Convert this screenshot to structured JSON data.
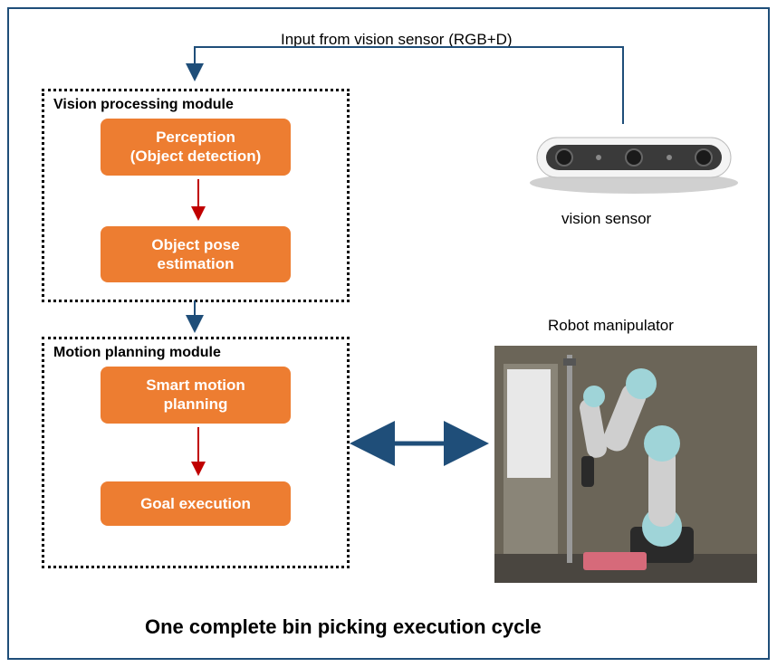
{
  "input_label": "Input from vision sensor (RGB+D)",
  "vision_module_title": "Vision processing module",
  "perception_box": "Perception\n(Object detection)",
  "pose_box": "Object pose\nestimation",
  "motion_module_title": "Motion planning module",
  "smart_box": "Smart motion\nplanning",
  "goal_box": "Goal execution",
  "sensor_label": "vision sensor",
  "robot_label": "Robot manipulator",
  "caption": "One complete bin picking execution cycle",
  "colors": {
    "orange": "#ed7d31",
    "border": "#1f4e79",
    "dark_arrow": "#1f4e79",
    "red_arrow": "#c00000"
  }
}
